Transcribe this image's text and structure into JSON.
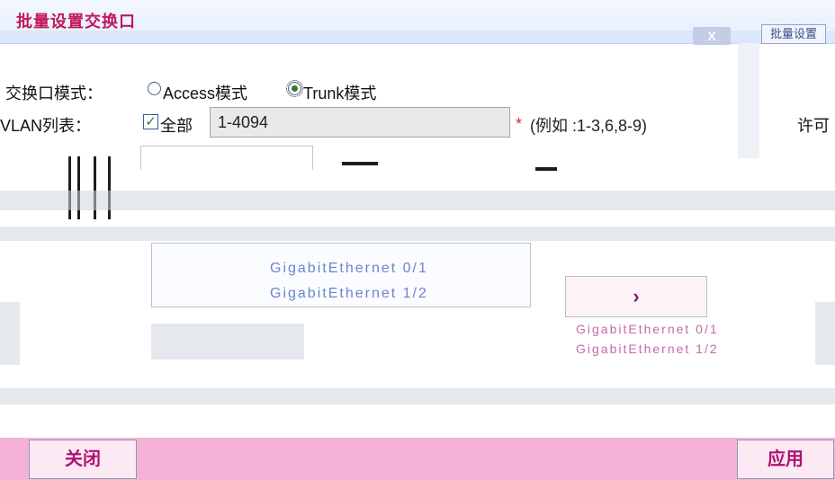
{
  "window": {
    "title": "批量设置交换口",
    "close_label": "X",
    "right_tab_label": "批量设置"
  },
  "port_mode": {
    "label": "交换口模式：",
    "options": [
      {
        "label": "Access模式",
        "selected": false
      },
      {
        "label": "Trunk模式",
        "selected": true
      }
    ]
  },
  "vlan_list": {
    "label": "VLAN列表：",
    "label_prefix": "",
    "all_label": "全部",
    "all_checked": true,
    "value": "1-4094",
    "required_mark": "*",
    "hint": "(例如 :1-3,6,8-9)",
    "right_label": "许可"
  },
  "ports": {
    "items": [
      "GigabitEthernet 0/1",
      "GigabitEthernet 1/2"
    ],
    "move_right_label": "›",
    "right_panel_lines": [
      "GigabitEthernet 0/1",
      "GigabitEthernet 1/2"
    ]
  },
  "footer": {
    "close_label": "关闭",
    "apply_label": "应用"
  },
  "colors": {
    "footer": "#f4b3d6",
    "accent": "#c2185b",
    "button_text": "#b0126d"
  }
}
